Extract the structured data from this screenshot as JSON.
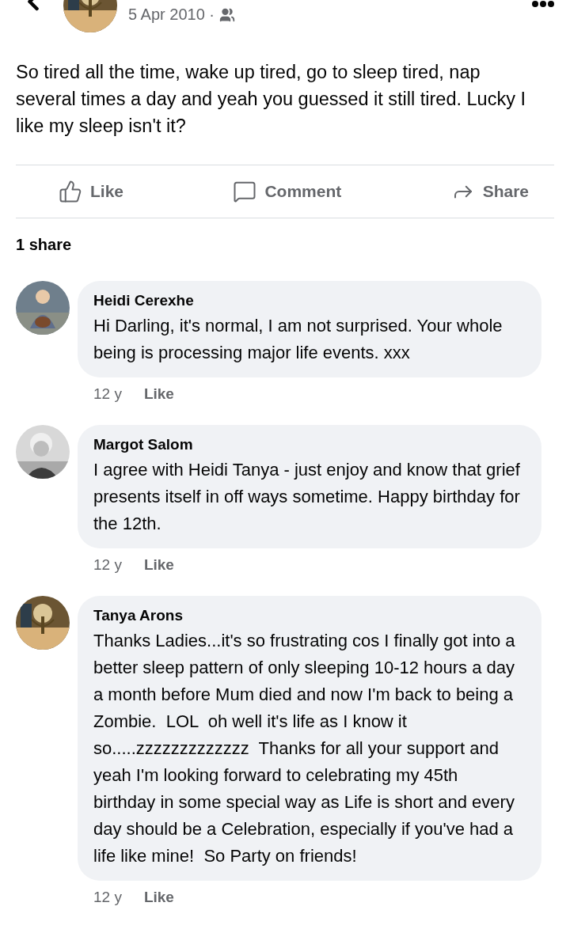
{
  "post": {
    "date": "5 Apr 2010 ·",
    "text": "So tired all the time, wake up tired, go to sleep tired, nap several times a day and yeah you guessed it still tired. Lucky I like my sleep isn't it?"
  },
  "actions": [
    {
      "kind": "like",
      "label": "Like"
    },
    {
      "kind": "comment",
      "label": "Comment"
    },
    {
      "kind": "share",
      "label": "Share"
    }
  ],
  "share_count": "1 share",
  "comments": [
    {
      "author": "Heidi Cerexhe",
      "text": "Hi Darling, it's normal, I am not surprised. Your whole being is processing major life events. xxx",
      "age": "12 y",
      "like": "Like"
    },
    {
      "author": "Margot Salom",
      "text": "I agree with Heidi Tanya - just enjoy and know that grief presents itself in off ways sometime. Happy birthday for the 12th.",
      "age": "12 y",
      "like": "Like"
    },
    {
      "author": "Tanya Arons",
      "text": "Thanks Ladies...it's so frustrating cos I finally got into a better sleep pattern of only sleeping 10-12 hours a day a month before Mum died and now I'm back to being a Zombie.  LOL  oh well it's life as I know it so.....zzzzzzzzzzzzz  Thanks for all your support and yeah I'm looking forward to celebrating my 45th birthday in some special way as Life is short and every day should be a Celebration, especially if you've had a life like mine!  So Party on friends!",
      "age": "12 y",
      "like": "Like"
    }
  ]
}
